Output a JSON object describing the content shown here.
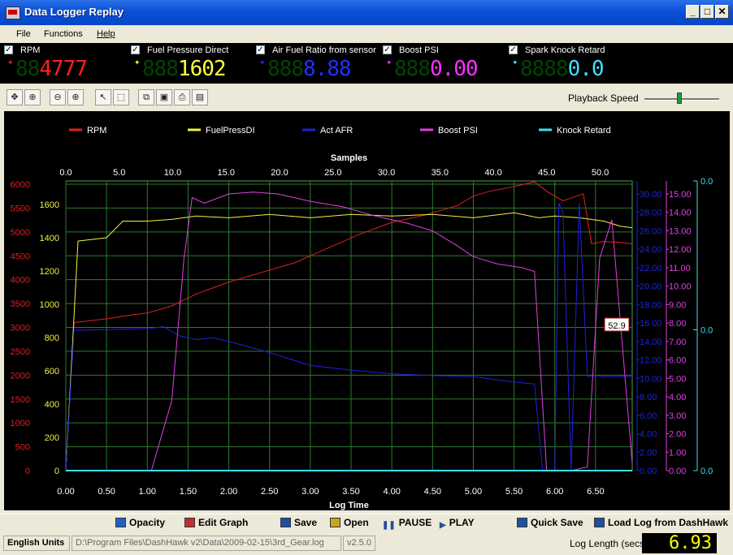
{
  "window": {
    "title": "Data Logger Replay",
    "controls": [
      "_",
      "□",
      "✕"
    ]
  },
  "menu": [
    {
      "label": "File"
    },
    {
      "label": "Functions"
    },
    {
      "label": "Help"
    }
  ],
  "gauges": [
    {
      "label": "RPM",
      "checked": true,
      "dim_digits": "88",
      "value": "4777",
      "color": "#ff2020"
    },
    {
      "label": "Fuel Pressure Direct",
      "checked": true,
      "dim_digits": "888",
      "value": "1602",
      "color": "#ffff40"
    },
    {
      "label": "Air Fuel Ratio from sensor",
      "checked": true,
      "dim_digits": "888",
      "value": "8.88",
      "color": "#2030ff"
    },
    {
      "label": "Boost PSI",
      "checked": true,
      "dim_digits": "888",
      "value": "0.00",
      "color": "#ff30ff"
    },
    {
      "label": "Spark Knock Retard",
      "checked": true,
      "dim_digits": "8888",
      "value": "0.0",
      "color": "#40e0ff"
    }
  ],
  "toolbar": {
    "icons": [
      "pan-icon",
      "zoom-fit-icon",
      "zoom-out-icon",
      "zoom-in-icon",
      "pointer-icon",
      "select-box-icon",
      "copy-icon",
      "save-icon",
      "print-icon",
      "print-preview-icon"
    ],
    "playback_label": "Playback Speed",
    "playback_level": 0.47
  },
  "chart_data": {
    "type": "line",
    "x_top_label": "Samples",
    "x_bottom_label": "Log Time",
    "x_top_ticks": [
      "0.0",
      "5.0",
      "10.0",
      "15.0",
      "20.0",
      "25.0",
      "30.0",
      "35.0",
      "40.0",
      "45.0",
      "50.0"
    ],
    "x_bottom_ticks": [
      "0.00",
      "0.50",
      "1.00",
      "1.50",
      "2.00",
      "2.50",
      "3.00",
      "3.50",
      "4.00",
      "4.50",
      "5.00",
      "5.50",
      "6.00",
      "6.50"
    ],
    "xlim": [
      0,
      6.95
    ],
    "cursor_label": "52.9",
    "legend": [
      {
        "name": "RPM",
        "color": "#e02020"
      },
      {
        "name": "FuelPressDI",
        "color": "#f0f040"
      },
      {
        "name": "Act AFR",
        "color": "#2020e0"
      },
      {
        "name": "Boost PSI",
        "color": "#e040e0"
      },
      {
        "name": "Knock Retard",
        "color": "#40e0f0"
      }
    ],
    "axes": {
      "rpm": {
        "ticks": [
          "0",
          "500",
          "1000",
          "1500",
          "2000",
          "2500",
          "3000",
          "3500",
          "4000",
          "4500",
          "5000",
          "5500",
          "6000"
        ],
        "ylim": [
          0,
          6000
        ],
        "color": "#e02020"
      },
      "fuel": {
        "ticks": [
          "0",
          "200",
          "400",
          "600",
          "800",
          "1000",
          "1200",
          "1400",
          "1600"
        ],
        "ylim": [
          0,
          1600
        ],
        "color": "#f0f040"
      },
      "afr": {
        "ticks": [
          "0.00",
          "2.00",
          "4.00",
          "6.00",
          "8.00",
          "10.00",
          "12.00",
          "14.00",
          "16.00",
          "18.00",
          "20.00",
          "22.00",
          "24.00",
          "26.00",
          "28.00",
          "30.00"
        ],
        "ylim": [
          0,
          30
        ],
        "color": "#2020e0"
      },
      "boost": {
        "ticks": [
          "0.00",
          "1.00",
          "2.00",
          "3.00",
          "4.00",
          "5.00",
          "6.00",
          "7.00",
          "8.00",
          "9.00",
          "10.00",
          "11.00",
          "12.00",
          "13.00",
          "14.00",
          "15.00"
        ],
        "ylim": [
          0,
          15
        ],
        "color": "#e040e0"
      },
      "knock": {
        "ticks": [
          "0.0",
          "0.0",
          "0.0"
        ],
        "ylim": [
          0,
          1
        ],
        "color": "#40e0f0"
      }
    },
    "series": [
      {
        "name": "RPM",
        "axis": "rpm",
        "color": "#e02020",
        "x": [
          0.0,
          0.1,
          0.5,
          0.8,
          1.0,
          1.3,
          1.6,
          2.0,
          2.4,
          2.8,
          3.2,
          3.6,
          4.0,
          4.4,
          4.8,
          5.0,
          5.2,
          5.5,
          5.75,
          5.9,
          6.1,
          6.35,
          6.45,
          6.6,
          6.8,
          6.95
        ],
        "y": [
          0,
          3100,
          3180,
          3260,
          3300,
          3450,
          3700,
          3950,
          4150,
          4350,
          4650,
          4950,
          5200,
          5350,
          5550,
          5750,
          5850,
          5950,
          6050,
          5850,
          5650,
          5800,
          4750,
          4800,
          4780,
          4750
        ]
      },
      {
        "name": "FuelPressDI",
        "axis": "fuel",
        "color": "#f0f040",
        "x": [
          0.0,
          0.15,
          0.5,
          0.7,
          1.0,
          1.3,
          1.6,
          2.0,
          2.5,
          3.0,
          3.5,
          4.0,
          4.5,
          5.0,
          5.5,
          5.8,
          6.0,
          6.3,
          6.6,
          6.8,
          6.95
        ],
        "y": [
          0,
          1380,
          1400,
          1500,
          1500,
          1510,
          1530,
          1520,
          1540,
          1520,
          1540,
          1530,
          1540,
          1520,
          1550,
          1520,
          1530,
          1520,
          1500,
          1470,
          1460
        ]
      },
      {
        "name": "Act AFR",
        "axis": "afr",
        "color": "#2020e0",
        "x": [
          0.0,
          0.1,
          0.5,
          1.0,
          1.2,
          1.4,
          1.6,
          1.8,
          2.0,
          2.5,
          3.0,
          3.5,
          4.0,
          4.5,
          5.0,
          5.5,
          5.75,
          5.85,
          6.0,
          6.05,
          6.1,
          6.2,
          6.3,
          6.4,
          6.5,
          6.6,
          6.95
        ],
        "y": [
          0,
          15.2,
          15.3,
          15.4,
          15.6,
          14.6,
          14.2,
          14.4,
          14.0,
          12.8,
          11.4,
          10.9,
          10.5,
          10.3,
          10.2,
          9.6,
          9.4,
          0,
          0,
          29,
          28,
          0,
          29,
          10.2,
          10.3,
          10.2,
          10.2
        ]
      },
      {
        "name": "Boost PSI",
        "axis": "boost",
        "color": "#e040e0",
        "x": [
          0.0,
          1.05,
          1.3,
          1.45,
          1.55,
          1.7,
          2.0,
          2.3,
          2.6,
          3.0,
          3.4,
          3.8,
          4.2,
          4.5,
          4.8,
          5.0,
          5.3,
          5.6,
          5.75,
          5.9,
          6.0,
          6.2,
          6.4,
          6.55,
          6.7,
          6.95
        ],
        "y": [
          0,
          0,
          3.8,
          11.5,
          14.8,
          14.5,
          15.0,
          15.1,
          15.0,
          14.6,
          14.3,
          13.8,
          13.4,
          13.0,
          12.2,
          11.6,
          11.2,
          11.0,
          10.8,
          0,
          0,
          0,
          0.2,
          11.5,
          13.6,
          0.4
        ]
      },
      {
        "name": "Knock Retard",
        "axis": "knock",
        "color": "#40e0f0",
        "x": [
          0.0,
          6.95
        ],
        "y": [
          0,
          0
        ]
      }
    ]
  },
  "actions": [
    {
      "name": "opacity-button",
      "label": "Opacity",
      "icon": "opacity-icon"
    },
    {
      "name": "edit-graph-button",
      "label": "Edit Graph",
      "icon": "edit-graph-icon"
    },
    {
      "name": "save-log-button",
      "label": "Save",
      "icon": "save-icon"
    },
    {
      "name": "open-log-button",
      "label": "Open",
      "icon": "open-folder-icon"
    },
    {
      "name": "pause-button",
      "label": "PAUSE",
      "icon": "pause-icon"
    },
    {
      "name": "play-button",
      "label": "PLAY",
      "icon": "play-icon"
    },
    {
      "name": "quick-save-button",
      "label": "Quick Save",
      "icon": "quick-save-icon"
    },
    {
      "name": "load-log-button",
      "label": "Load Log from DashHawk",
      "icon": "load-log-icon"
    }
  ],
  "status": {
    "units": "English Units",
    "path": "D:\\Program Files\\DashHawk v2\\Data\\2009-02-15\\3rd_Gear.log",
    "version": "v2.5.0",
    "log_length_label": "Log Length (secs)",
    "log_length_value": "6.93"
  }
}
